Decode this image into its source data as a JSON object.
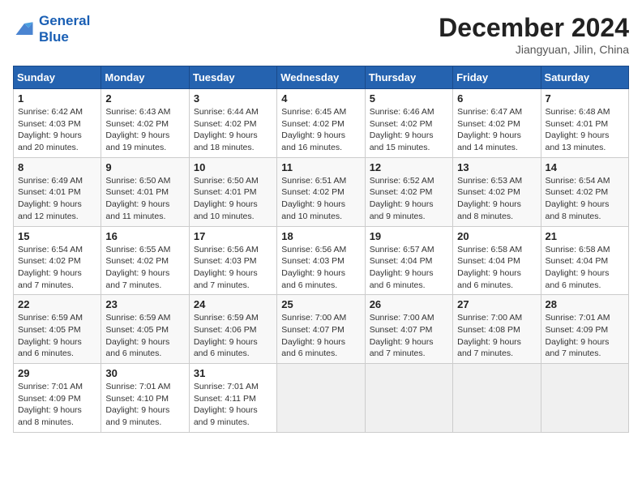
{
  "header": {
    "logo_line1": "General",
    "logo_line2": "Blue",
    "month": "December 2024",
    "location": "Jiangyuan, Jilin, China"
  },
  "weekdays": [
    "Sunday",
    "Monday",
    "Tuesday",
    "Wednesday",
    "Thursday",
    "Friday",
    "Saturday"
  ],
  "weeks": [
    [
      {
        "day": "1",
        "info": "Sunrise: 6:42 AM\nSunset: 4:03 PM\nDaylight: 9 hours\nand 20 minutes."
      },
      {
        "day": "2",
        "info": "Sunrise: 6:43 AM\nSunset: 4:02 PM\nDaylight: 9 hours\nand 19 minutes."
      },
      {
        "day": "3",
        "info": "Sunrise: 6:44 AM\nSunset: 4:02 PM\nDaylight: 9 hours\nand 18 minutes."
      },
      {
        "day": "4",
        "info": "Sunrise: 6:45 AM\nSunset: 4:02 PM\nDaylight: 9 hours\nand 16 minutes."
      },
      {
        "day": "5",
        "info": "Sunrise: 6:46 AM\nSunset: 4:02 PM\nDaylight: 9 hours\nand 15 minutes."
      },
      {
        "day": "6",
        "info": "Sunrise: 6:47 AM\nSunset: 4:02 PM\nDaylight: 9 hours\nand 14 minutes."
      },
      {
        "day": "7",
        "info": "Sunrise: 6:48 AM\nSunset: 4:01 PM\nDaylight: 9 hours\nand 13 minutes."
      }
    ],
    [
      {
        "day": "8",
        "info": "Sunrise: 6:49 AM\nSunset: 4:01 PM\nDaylight: 9 hours\nand 12 minutes."
      },
      {
        "day": "9",
        "info": "Sunrise: 6:50 AM\nSunset: 4:01 PM\nDaylight: 9 hours\nand 11 minutes."
      },
      {
        "day": "10",
        "info": "Sunrise: 6:50 AM\nSunset: 4:01 PM\nDaylight: 9 hours\nand 10 minutes."
      },
      {
        "day": "11",
        "info": "Sunrise: 6:51 AM\nSunset: 4:02 PM\nDaylight: 9 hours\nand 10 minutes."
      },
      {
        "day": "12",
        "info": "Sunrise: 6:52 AM\nSunset: 4:02 PM\nDaylight: 9 hours\nand 9 minutes."
      },
      {
        "day": "13",
        "info": "Sunrise: 6:53 AM\nSunset: 4:02 PM\nDaylight: 9 hours\nand 8 minutes."
      },
      {
        "day": "14",
        "info": "Sunrise: 6:54 AM\nSunset: 4:02 PM\nDaylight: 9 hours\nand 8 minutes."
      }
    ],
    [
      {
        "day": "15",
        "info": "Sunrise: 6:54 AM\nSunset: 4:02 PM\nDaylight: 9 hours\nand 7 minutes."
      },
      {
        "day": "16",
        "info": "Sunrise: 6:55 AM\nSunset: 4:02 PM\nDaylight: 9 hours\nand 7 minutes."
      },
      {
        "day": "17",
        "info": "Sunrise: 6:56 AM\nSunset: 4:03 PM\nDaylight: 9 hours\nand 7 minutes."
      },
      {
        "day": "18",
        "info": "Sunrise: 6:56 AM\nSunset: 4:03 PM\nDaylight: 9 hours\nand 6 minutes."
      },
      {
        "day": "19",
        "info": "Sunrise: 6:57 AM\nSunset: 4:04 PM\nDaylight: 9 hours\nand 6 minutes."
      },
      {
        "day": "20",
        "info": "Sunrise: 6:58 AM\nSunset: 4:04 PM\nDaylight: 9 hours\nand 6 minutes."
      },
      {
        "day": "21",
        "info": "Sunrise: 6:58 AM\nSunset: 4:04 PM\nDaylight: 9 hours\nand 6 minutes."
      }
    ],
    [
      {
        "day": "22",
        "info": "Sunrise: 6:59 AM\nSunset: 4:05 PM\nDaylight: 9 hours\nand 6 minutes."
      },
      {
        "day": "23",
        "info": "Sunrise: 6:59 AM\nSunset: 4:05 PM\nDaylight: 9 hours\nand 6 minutes."
      },
      {
        "day": "24",
        "info": "Sunrise: 6:59 AM\nSunset: 4:06 PM\nDaylight: 9 hours\nand 6 minutes."
      },
      {
        "day": "25",
        "info": "Sunrise: 7:00 AM\nSunset: 4:07 PM\nDaylight: 9 hours\nand 6 minutes."
      },
      {
        "day": "26",
        "info": "Sunrise: 7:00 AM\nSunset: 4:07 PM\nDaylight: 9 hours\nand 7 minutes."
      },
      {
        "day": "27",
        "info": "Sunrise: 7:00 AM\nSunset: 4:08 PM\nDaylight: 9 hours\nand 7 minutes."
      },
      {
        "day": "28",
        "info": "Sunrise: 7:01 AM\nSunset: 4:09 PM\nDaylight: 9 hours\nand 7 minutes."
      }
    ],
    [
      {
        "day": "29",
        "info": "Sunrise: 7:01 AM\nSunset: 4:09 PM\nDaylight: 9 hours\nand 8 minutes."
      },
      {
        "day": "30",
        "info": "Sunrise: 7:01 AM\nSunset: 4:10 PM\nDaylight: 9 hours\nand 9 minutes."
      },
      {
        "day": "31",
        "info": "Sunrise: 7:01 AM\nSunset: 4:11 PM\nDaylight: 9 hours\nand 9 minutes."
      },
      null,
      null,
      null,
      null
    ]
  ]
}
